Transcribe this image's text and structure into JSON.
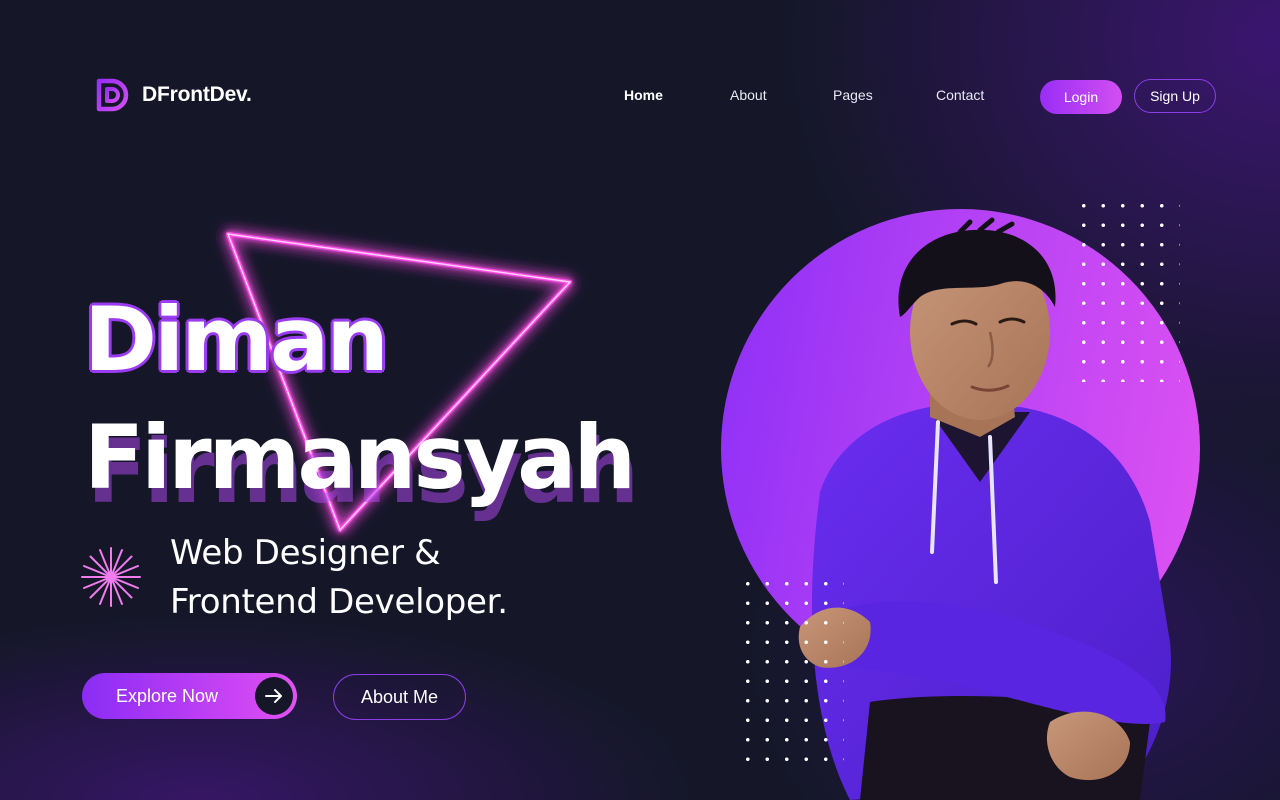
{
  "brand": {
    "name": "DFrontDev.",
    "logo_icon": "d-letter-logo-icon",
    "accent_color": "#9a3bf0",
    "accent_pink": "#e053f2",
    "background_color": "#151729"
  },
  "nav": {
    "items": [
      {
        "label": "Home",
        "active": true
      },
      {
        "label": "About",
        "active": false
      },
      {
        "label": "Pages",
        "active": false
      },
      {
        "label": "Contact",
        "active": false
      }
    ],
    "login_label": "Login",
    "signup_label": "Sign Up"
  },
  "hero": {
    "first_name": "Diman",
    "last_name": "Firmansyah",
    "tagline_line1": "Web Designer &",
    "tagline_line2": "Frontend Developer.",
    "tagline_icon": "starburst-icon",
    "explore_label": "Explore Now",
    "explore_icon": "arrow-right-icon",
    "about_label": "About Me"
  },
  "illustration": {
    "decor_icon": "neon-triangle-icon",
    "portrait": "person-portrait-purple-hoodie",
    "dots": "dot-grid-pattern"
  }
}
